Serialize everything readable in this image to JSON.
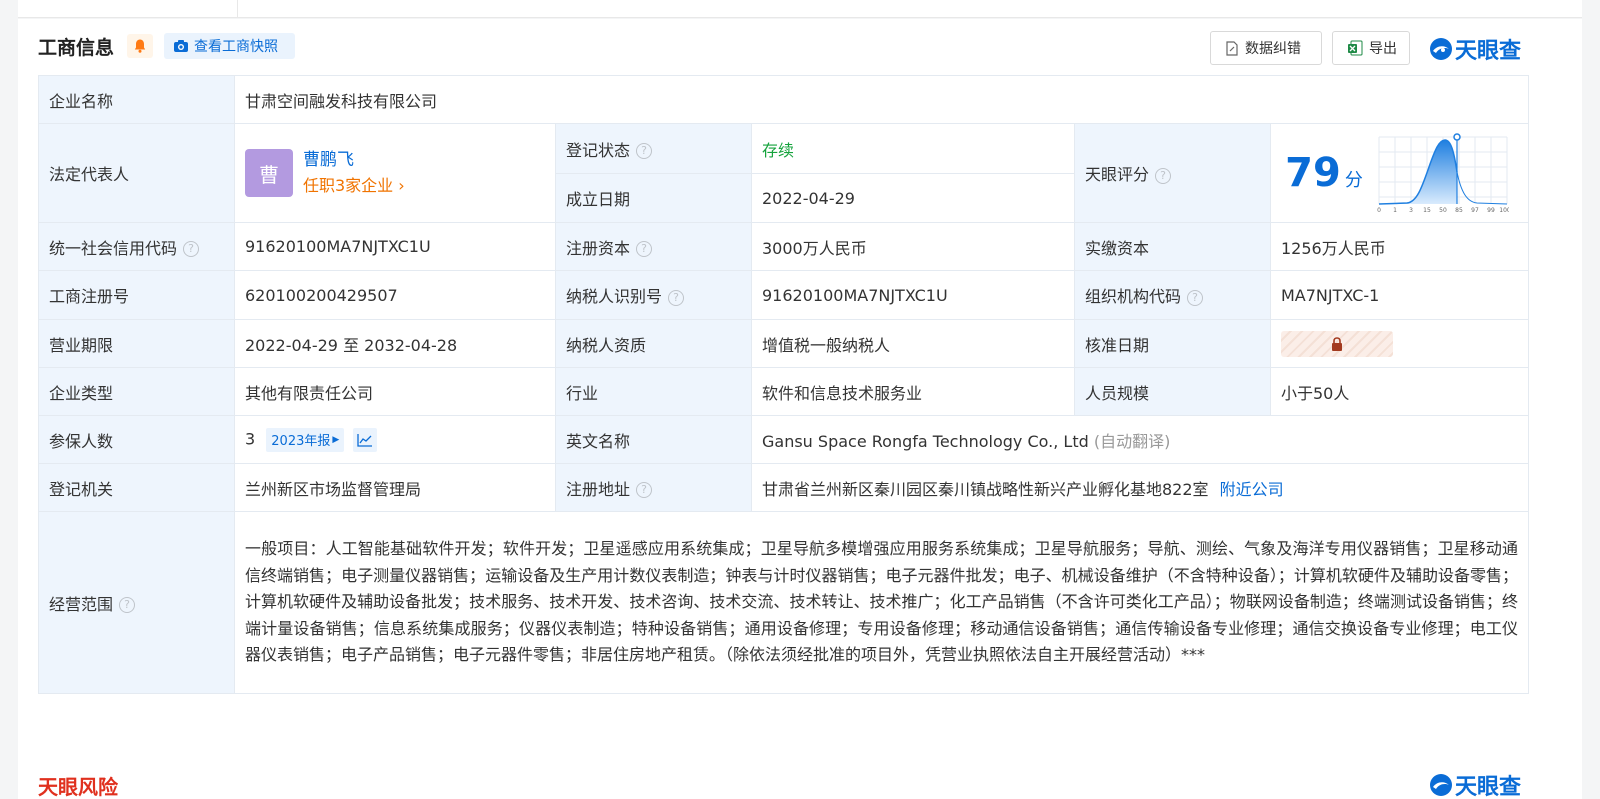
{
  "header": {
    "title": "工商信息",
    "snapshot_label": "查看工商快照",
    "correction_label": "数据纠错",
    "export_label": "导出",
    "brand": "天眼查"
  },
  "rows": {
    "company_name_label": "企业名称",
    "company_name": "甘肃空间融发科技有限公司",
    "legal_rep_label": "法定代表人",
    "legal_rep_avatar": "曹",
    "legal_rep_name": "曹鹏飞",
    "legal_rep_positions": "任职3家企业",
    "reg_status_label": "登记状态",
    "reg_status": "存续",
    "found_date_label": "成立日期",
    "found_date": "2022-04-29",
    "score_label": "天眼评分",
    "score_value": "79",
    "score_unit": "分",
    "score_ticks": [
      "0",
      "1",
      "3",
      "15",
      "50",
      "85",
      "97",
      "99",
      "100"
    ],
    "credit_code_label": "统一社会信用代码",
    "credit_code": "91620100MA7NJTXC1U",
    "reg_capital_label": "注册资本",
    "reg_capital": "3000万人民币",
    "paid_capital_label": "实缴资本",
    "paid_capital": "1256万人民币",
    "biz_reg_no_label": "工商注册号",
    "biz_reg_no": "620100200429507",
    "taxpayer_id_label": "纳税人识别号",
    "taxpayer_id": "91620100MA7NJTXC1U",
    "org_code_label": "组织机构代码",
    "org_code": "MA7NJTXC-1",
    "term_label": "营业期限",
    "term": "2022-04-29 至 2032-04-28",
    "tax_qual_label": "纳税人资质",
    "tax_qual": "增值税一般纳税人",
    "approval_date_label": "核准日期",
    "type_label": "企业类型",
    "type": "其他有限责任公司",
    "industry_label": "行业",
    "industry": "软件和信息技术服务业",
    "staff_label": "人员规模",
    "staff": "小于50人",
    "insured_label": "参保人数",
    "insured": "3",
    "insured_year": "2023年报",
    "english_name_label": "英文名称",
    "english_name": "Gansu Space Rongfa Technology Co., Ltd",
    "english_name_note": "(自动翻译)",
    "authority_label": "登记机关",
    "authority": "兰州新区市场监督管理局",
    "address_label": "注册地址",
    "address": "甘肃省兰州新区秦川园区秦川镇战略性新兴产业孵化基地822室",
    "nearby_label": "附近公司",
    "scope_label": "经营范围",
    "scope": "一般项目：人工智能基础软件开发；软件开发；卫星遥感应用系统集成；卫星导航多模增强应用服务系统集成；卫星导航服务；导航、测绘、气象及海洋专用仪器销售；卫星移动通信终端销售；电子测量仪器销售；运输设备及生产用计数仪表制造；钟表与计时仪器销售；电子元器件批发；电子、机械设备维护（不含特种设备）；计算机软硬件及辅助设备零售；计算机软硬件及辅助设备批发；技术服务、技术开发、技术咨询、技术交流、技术转让、技术推广；化工产品销售（不含许可类化工产品）；物联网设备制造；终端测试设备销售；终端计量设备销售；信息系统集成服务；仪器仪表制造；特种设备销售；通用设备修理；专用设备修理；移动通信设备销售；通信传输设备专业修理；通信交换设备专业修理；电工仪器仪表销售；电子产品销售；电子元器件零售；非居住房地产租赁。（除依法须经批准的项目外，凭营业执照依法自主开展经营活动）***"
  },
  "next_section": {
    "title": "天眼风险"
  },
  "colors": {
    "accent": "#0a6cd6",
    "label_bg": "#eef5fd",
    "status_green": "#15a33c",
    "orange": "#f07300",
    "risk_red": "#e0301e"
  }
}
